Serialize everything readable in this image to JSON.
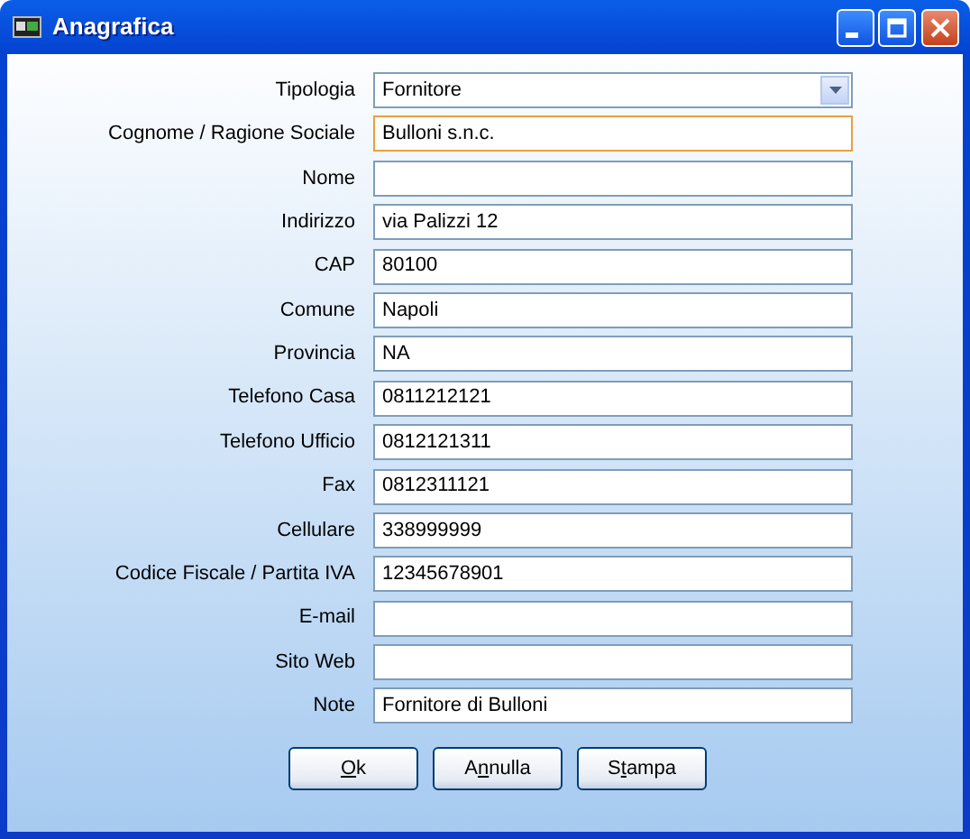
{
  "window": {
    "title": "Anagrafica"
  },
  "fields": [
    {
      "label": "Tipologia",
      "kind": "dropdown",
      "value": "Fornitore",
      "focused": false
    },
    {
      "label": "Cognome / Ragione Sociale",
      "kind": "text",
      "value": "Bulloni s.n.c.",
      "focused": true
    },
    {
      "label": "Nome",
      "kind": "text",
      "focused": false
    },
    {
      "label": "Indirizzo",
      "kind": "text",
      "value": "via Palizzi 12",
      "focused": false
    },
    {
      "label": "CAP",
      "kind": "text",
      "value": "80100",
      "focused": false
    },
    {
      "label": "Comune",
      "kind": "text",
      "value": "Napoli",
      "focused": false
    },
    {
      "label": "Provincia",
      "kind": "text",
      "value": "NA",
      "focused": false
    },
    {
      "label": "Telefono Casa",
      "kind": "text",
      "value": "0811212121",
      "focused": false
    },
    {
      "label": "Telefono Ufficio",
      "kind": "text",
      "value": "0812121311",
      "focused": false
    },
    {
      "label": "Fax",
      "kind": "text",
      "value": "0812311121",
      "focused": false
    },
    {
      "label": "Cellulare",
      "kind": "text",
      "value": "338999999",
      "focused": false
    },
    {
      "label": "Codice Fiscale / Partita IVA",
      "kind": "text",
      "value": "12345678901",
      "focused": false
    },
    {
      "label": "E-mail",
      "kind": "text",
      "focused": false
    },
    {
      "label": "Sito Web",
      "kind": "text",
      "focused": false
    },
    {
      "label": "Note",
      "kind": "text",
      "value": "Fornitore di Bulloni",
      "focused": false
    }
  ],
  "buttons": [
    {
      "key": "O",
      "after": "k"
    },
    {
      "before": "A",
      "key": "n",
      "after": "nulla"
    },
    {
      "before": "S",
      "key": "t",
      "after": "ampa"
    }
  ]
}
